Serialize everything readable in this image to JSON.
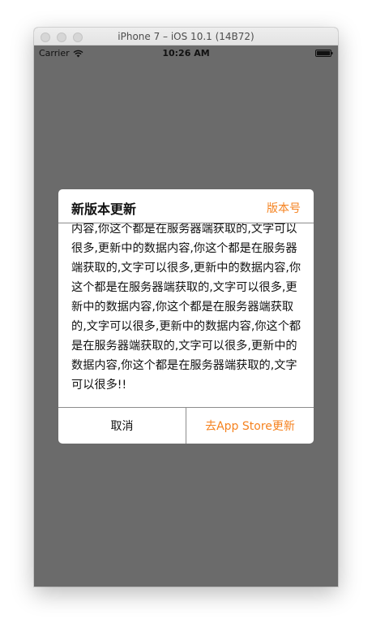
{
  "window": {
    "title": "iPhone 7 – iOS 10.1 (14B72)"
  },
  "statusbar": {
    "carrier": "Carrier",
    "time": "10:26 AM",
    "wifi_icon": "wifi-icon",
    "battery_icon": "battery-icon"
  },
  "dialog": {
    "title": "新版本更新",
    "version_label": "版本号",
    "body": "内容,你这个都是在服务器端获取的,文字可以很多,更新中的数据内容,你这个都是在服务器端获取的,文字可以很多,更新中的数据内容,你这个都是在服务器端获取的,文字可以很多,更新中的数据内容,你这个都是在服务器端获取的,文字可以很多,更新中的数据内容,你这个都是在服务器端获取的,文字可以很多,更新中的数据内容,你这个都是在服务器端获取的,文字可以很多!!",
    "cancel_label": "取消",
    "update_label": "去App Store更新"
  },
  "colors": {
    "accent": "#f5821f",
    "overlay": "#6b6b6b",
    "divider": "#8c8c8c"
  }
}
